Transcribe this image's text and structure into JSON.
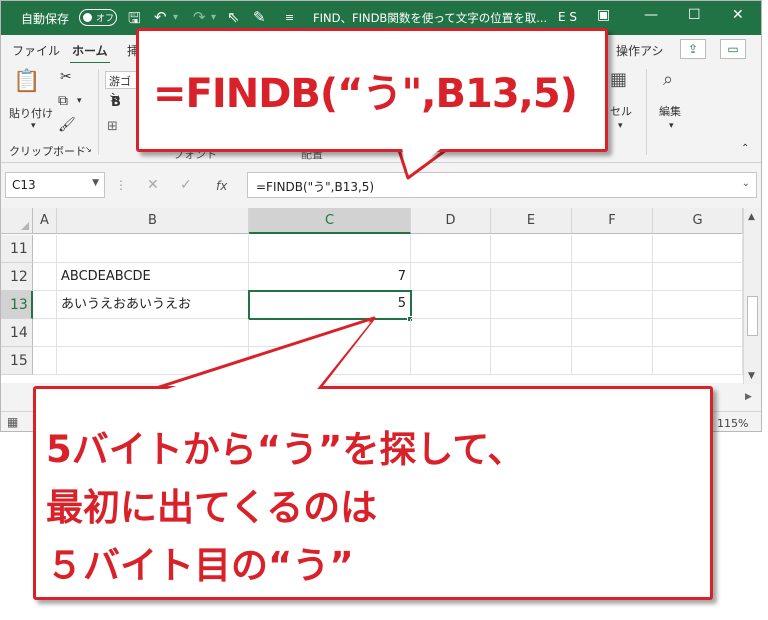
{
  "titlebar": {
    "autosave_label": "自動保存",
    "autosave_state": "オフ",
    "document_title": "FIND、FINDB関数を使って文字の位置を取...",
    "user_initials": "E S"
  },
  "tabs": [
    {
      "label": "ファイル"
    },
    {
      "label": "ホーム"
    },
    {
      "label": "挿"
    }
  ],
  "tab_right_label": "操作アシ",
  "ribbon": {
    "paste_label": "貼り付け",
    "clipboard_group": "クリップボード",
    "font_name": "游ゴシ",
    "bold_label": "B",
    "cell_group_fragment": "セル",
    "edit_label": "編集",
    "font_group_fragment": "フォント",
    "align_group_fragment": "配置"
  },
  "formula_bar": {
    "name_box": "C13",
    "fx_label": "fx",
    "formula": "=FINDB(\"う\",B13,5)"
  },
  "grid": {
    "columns": [
      "A",
      "B",
      "C",
      "D",
      "E",
      "F",
      "G"
    ],
    "selected_column": "C",
    "rows": [
      {
        "num": "11",
        "b": "",
        "c": ""
      },
      {
        "num": "12",
        "b": "ABCDEABCDE",
        "c": "7"
      },
      {
        "num": "13",
        "b": "あいうえおあいうえお",
        "c": "5"
      },
      {
        "num": "14",
        "b": "",
        "c": ""
      },
      {
        "num": "15",
        "b": "",
        "c": ""
      }
    ],
    "selected_row": "13"
  },
  "statusbar": {
    "zoom": "115%"
  },
  "callouts": {
    "top_formula": "=FINDB(“う\",B13,5)",
    "bottom_lines": [
      "5バイトから“う”を探して、",
      "最初に出てくるのは",
      " ５バイト目の“う”"
    ]
  },
  "colors": {
    "excel_green": "#217346",
    "callout_red": "#d9212a"
  }
}
